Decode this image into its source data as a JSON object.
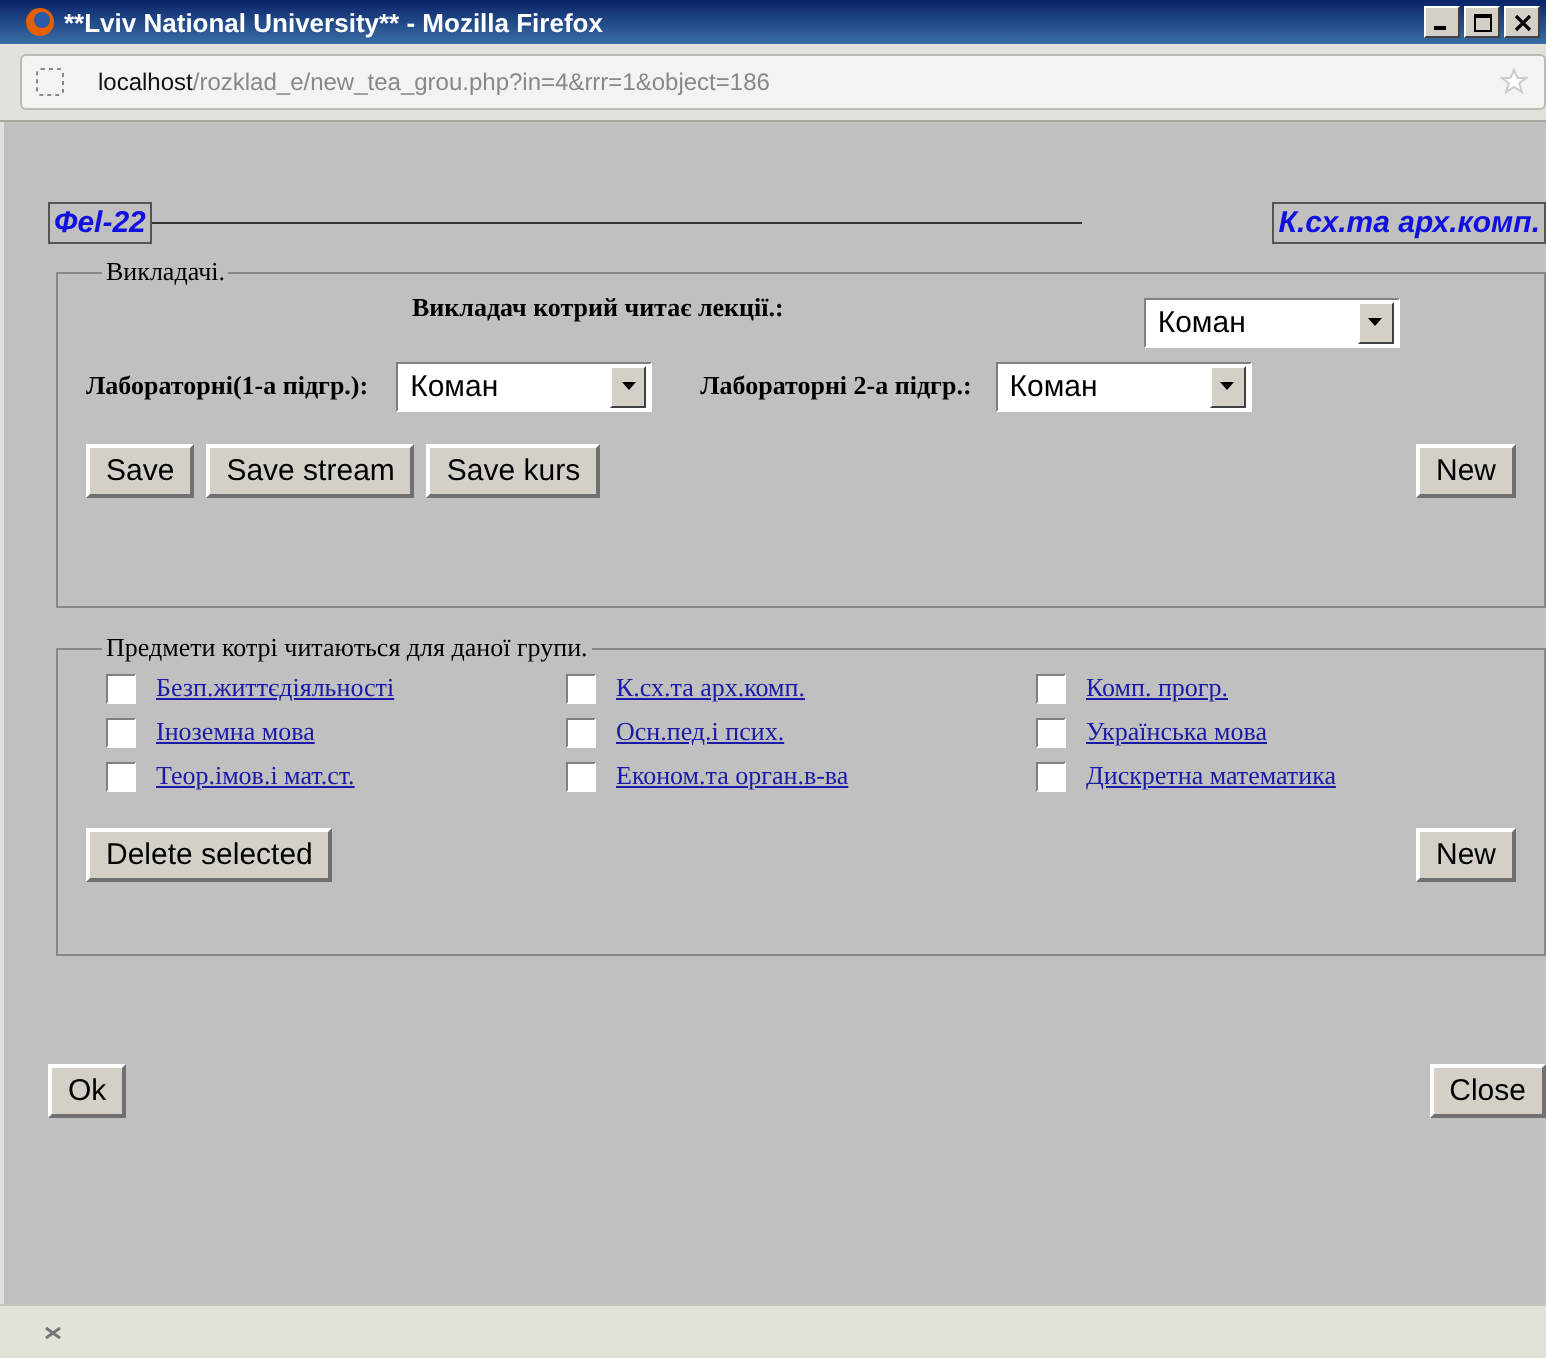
{
  "window": {
    "title": "**Lviv National University** - Mozilla Firefox"
  },
  "address_bar": {
    "host": "localhost",
    "path": "/rozklad_e/new_tea_grou.php?in=4&rrr=1&object=186"
  },
  "header": {
    "group": "Фel-22",
    "subject": "К.сх.та арх.комп."
  },
  "teachers": {
    "legend": "Викладачі.",
    "lecture": {
      "label": "Викладач котрий читає лекції.:",
      "value": "Коман"
    },
    "lab1": {
      "label": "Лабораторні(1-а підгр.):",
      "value": "Коман"
    },
    "lab2": {
      "label": "Лабораторні 2-а підгр.:",
      "value": "Коман"
    },
    "buttons": [
      "Save",
      "Save stream",
      "Save kurs"
    ],
    "new_button": "New"
  },
  "subjects": {
    "legend": "Предмети котрі читаються для даної групи.",
    "items": [
      {
        "label": "Безп.життєдіяльності",
        "checked": false
      },
      {
        "label": "К.сх.та арх.комп.",
        "checked": false
      },
      {
        "label": "Комп. прогр.",
        "checked": false
      },
      {
        "label": "Іноземна мова",
        "checked": false
      },
      {
        "label": "Осн.пед.і псих.",
        "checked": false
      },
      {
        "label": "Українська мова",
        "checked": false
      },
      {
        "label": "Теор.імов.і мат.ст.",
        "checked": false
      },
      {
        "label": "Економ.та орган.в-ва",
        "checked": false
      },
      {
        "label": "Дискретна математика",
        "checked": false
      }
    ],
    "delete_button": "Delete selected",
    "new_button": "New"
  },
  "footer": {
    "ok": "Ok",
    "close": "Close"
  }
}
